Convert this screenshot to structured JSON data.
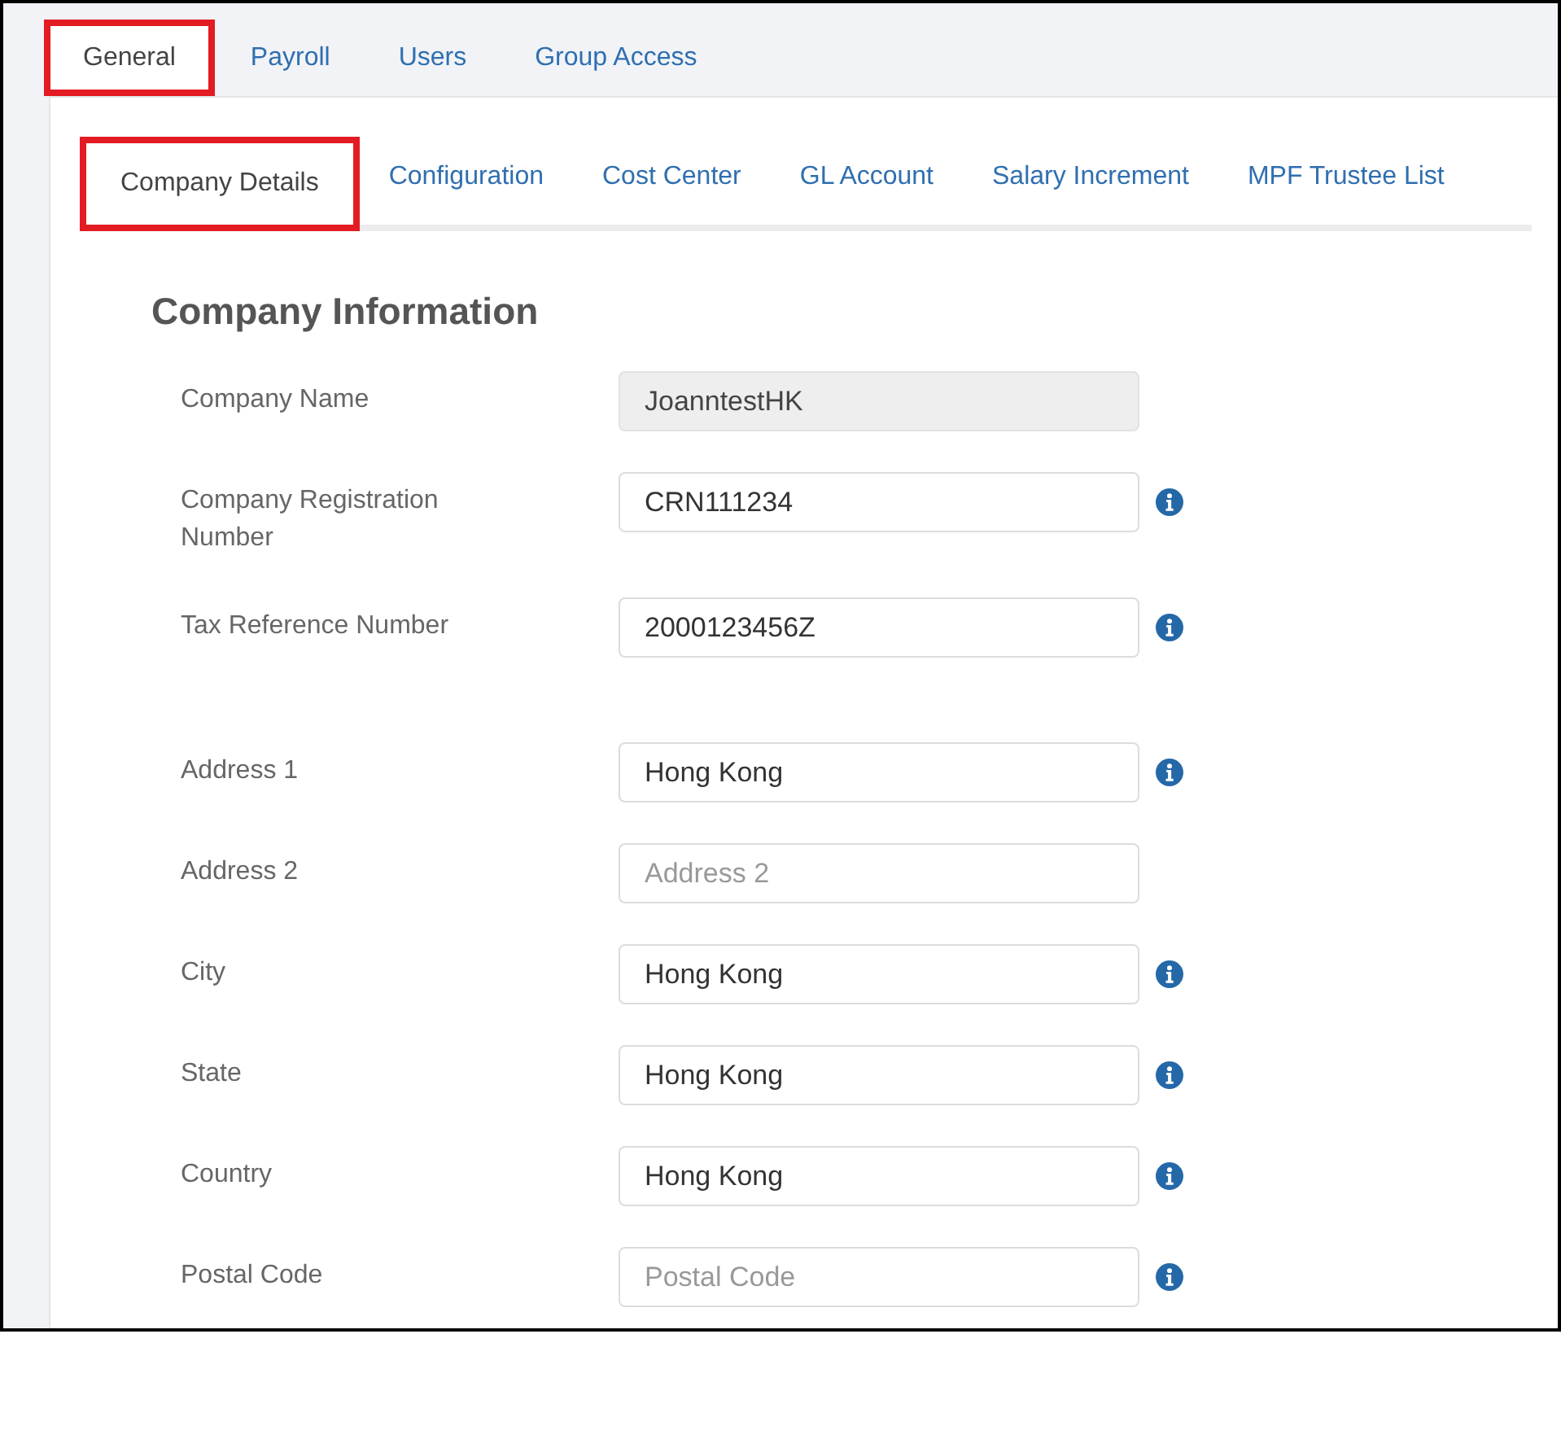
{
  "tabs": [
    {
      "label": "General",
      "selected": true
    },
    {
      "label": "Payroll",
      "selected": false
    },
    {
      "label": "Users",
      "selected": false
    },
    {
      "label": "Group Access",
      "selected": false
    }
  ],
  "sub_tabs": [
    {
      "label": "Company Details",
      "selected": true
    },
    {
      "label": "Configuration",
      "selected": false
    },
    {
      "label": "Cost Center",
      "selected": false
    },
    {
      "label": "GL Account",
      "selected": false
    },
    {
      "label": "Salary Increment",
      "selected": false
    },
    {
      "label": "MPF Trustee List",
      "selected": false
    }
  ],
  "form": {
    "title": "Company Information",
    "groups": [
      {
        "fields": [
          {
            "label": "Company Name",
            "value": "JoanntestHK",
            "disabled": true,
            "info": false
          },
          {
            "label": "Company Registration Number",
            "value": "CRN111234",
            "disabled": false,
            "info": true
          },
          {
            "label": "Tax Reference Number",
            "value": "2000123456Z",
            "disabled": false,
            "info": true
          }
        ]
      },
      {
        "fields": [
          {
            "label": "Address 1",
            "value": "Hong Kong",
            "disabled": false,
            "info": true
          },
          {
            "label": "Address 2",
            "placeholder": "Address 2",
            "disabled": false,
            "info": false
          },
          {
            "label": "City",
            "value": "Hong Kong",
            "disabled": false,
            "info": true
          },
          {
            "label": "State",
            "value": "Hong Kong",
            "disabled": false,
            "info": true
          },
          {
            "label": "Country",
            "value": "Hong Kong",
            "disabled": false,
            "info": true
          },
          {
            "label": "Postal Code",
            "placeholder": "Postal Code",
            "disabled": false,
            "info": true
          }
        ]
      }
    ]
  }
}
